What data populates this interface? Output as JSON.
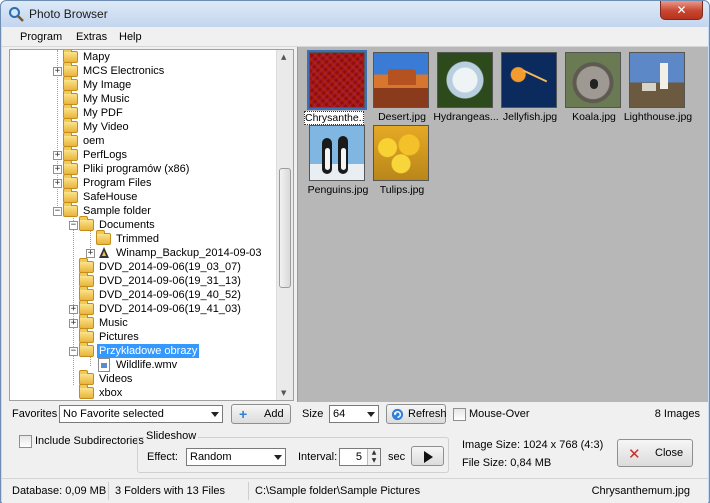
{
  "window": {
    "title": "Photo Browser",
    "close_glyph": "✕"
  },
  "menu": [
    "Program",
    "Extras",
    "Help"
  ],
  "tree": {
    "items": [
      {
        "label": "Mapy",
        "expander": ""
      },
      {
        "label": "MCS Electronics",
        "expander": "+"
      },
      {
        "label": "My Image",
        "expander": ""
      },
      {
        "label": "My Music",
        "expander": ""
      },
      {
        "label": "My PDF",
        "expander": ""
      },
      {
        "label": "My Video",
        "expander": ""
      },
      {
        "label": "oem",
        "expander": ""
      },
      {
        "label": "PerfLogs",
        "expander": "+"
      },
      {
        "label": "Pliki programów (x86)",
        "expander": "+"
      },
      {
        "label": "Program Files",
        "expander": "+"
      },
      {
        "label": "SafeHouse",
        "expander": ""
      },
      {
        "label": "Sample folder",
        "expander": "−"
      },
      {
        "label": "Documents",
        "expander": "−"
      },
      {
        "label": "Trimmed",
        "expander": ""
      },
      {
        "label": "Winamp_Backup_2014-09-03",
        "expander": "+"
      },
      {
        "label": "DVD_2014-09-06(19_03_07)",
        "expander": ""
      },
      {
        "label": "DVD_2014-09-06(19_31_13)",
        "expander": ""
      },
      {
        "label": "DVD_2014-09-06(19_40_52)",
        "expander": ""
      },
      {
        "label": "DVD_2014-09-06(19_41_03)",
        "expander": "+"
      },
      {
        "label": "Music",
        "expander": "+"
      },
      {
        "label": "Pictures",
        "expander": ""
      },
      {
        "label": "Przykładowe obrazy",
        "expander": "−"
      },
      {
        "label": "Wildlife.wmv",
        "expander": ""
      },
      {
        "label": "Videos",
        "expander": ""
      },
      {
        "label": "xbox",
        "expander": ""
      }
    ]
  },
  "thumbnails": [
    {
      "caption": "Chrysanthe...",
      "selected": true
    },
    {
      "caption": "Desert.jpg"
    },
    {
      "caption": "Hydrangeas..."
    },
    {
      "caption": "Jellyfish.jpg"
    },
    {
      "caption": "Koala.jpg"
    },
    {
      "caption": "Lighthouse.jpg"
    },
    {
      "caption": "Penguins.jpg"
    },
    {
      "caption": "Tulips.jpg"
    }
  ],
  "controls": {
    "favorites_label": "Favorites",
    "favorites_value": "No Favorite selected",
    "add_label": "Add",
    "size_label": "Size",
    "size_value": "64",
    "refresh_label": "Refresh",
    "mouseover_label": "Mouse-Over",
    "image_count": "8 Images",
    "include_subdirs_label": "Include Subdirectories",
    "slideshow_title": "Slideshow",
    "effect_label": "Effect:",
    "effect_value": "Random",
    "interval_label": "Interval:",
    "interval_value": "5",
    "sec_label": "sec",
    "image_size": "Image Size: 1024 x 768 (4:3)",
    "file_size": "File Size: 0,84 MB",
    "close_label": "Close"
  },
  "status": {
    "database": "Database: 0,09 MB",
    "folders": "3 Folders with 13 Files",
    "path": "C:\\Sample folder\\Sample Pictures",
    "file": "Chrysanthemum.jpg"
  },
  "colors": {
    "selection": "#3399ff",
    "thumb_background": "#b7b7b7",
    "close_red": "#c8452f"
  }
}
